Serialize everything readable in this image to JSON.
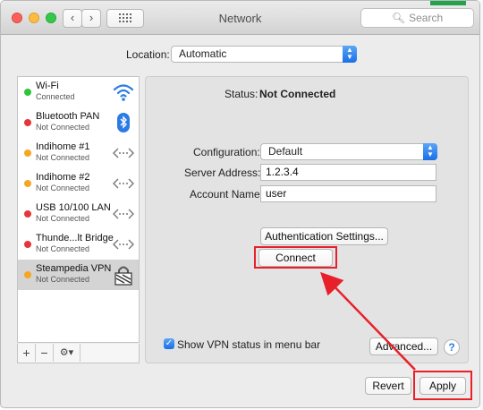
{
  "window": {
    "title": "Network",
    "search_placeholder": "Search"
  },
  "location": {
    "label": "Location:",
    "value": "Automatic"
  },
  "services": [
    {
      "name": "Wi-Fi",
      "status": "Connected",
      "dot_color": "#2fc43b",
      "icon": "wifi-icon"
    },
    {
      "name": "Bluetooth PAN",
      "status": "Not Connected",
      "dot_color": "#e5363a",
      "icon": "bluetooth-icon"
    },
    {
      "name": "Indihome #1",
      "status": "Not Connected",
      "dot_color": "#f5a623",
      "icon": "ethernet-arrows-icon"
    },
    {
      "name": "Indihome #2",
      "status": "Not Connected",
      "dot_color": "#f5a623",
      "icon": "ethernet-arrows-icon"
    },
    {
      "name": "USB 10/100 LAN",
      "status": "Not Connected",
      "dot_color": "#e5363a",
      "icon": "ethernet-arrows-icon"
    },
    {
      "name": "Thunde...lt Bridge",
      "status": "Not Connected",
      "dot_color": "#e5363a",
      "icon": "ethernet-arrows-icon"
    },
    {
      "name": "Steampedia VPN",
      "status": "Not Connected",
      "dot_color": "#f5a623",
      "icon": "vpn-lock-icon",
      "selected": true
    }
  ],
  "sidebar_toolbar": {
    "add": "+",
    "remove": "−",
    "gear": "⚙▾"
  },
  "detail": {
    "status_label": "Status:",
    "status_value": "Not Connected",
    "configuration_label": "Configuration:",
    "configuration_value": "Default",
    "server_label": "Server Address:",
    "server_value": "1.2.3.4",
    "account_label": "Account Name:",
    "account_value": "user",
    "auth_button": "Authentication Settings...",
    "connect_button": "Connect",
    "show_vpn_label": "Show VPN status in menu bar",
    "show_vpn_checked": true,
    "advanced_button": "Advanced...",
    "help": "?"
  },
  "footer": {
    "revert": "Revert",
    "apply": "Apply"
  },
  "colors": {
    "highlight": "#e8202a",
    "accent": "#1a6fe6"
  }
}
